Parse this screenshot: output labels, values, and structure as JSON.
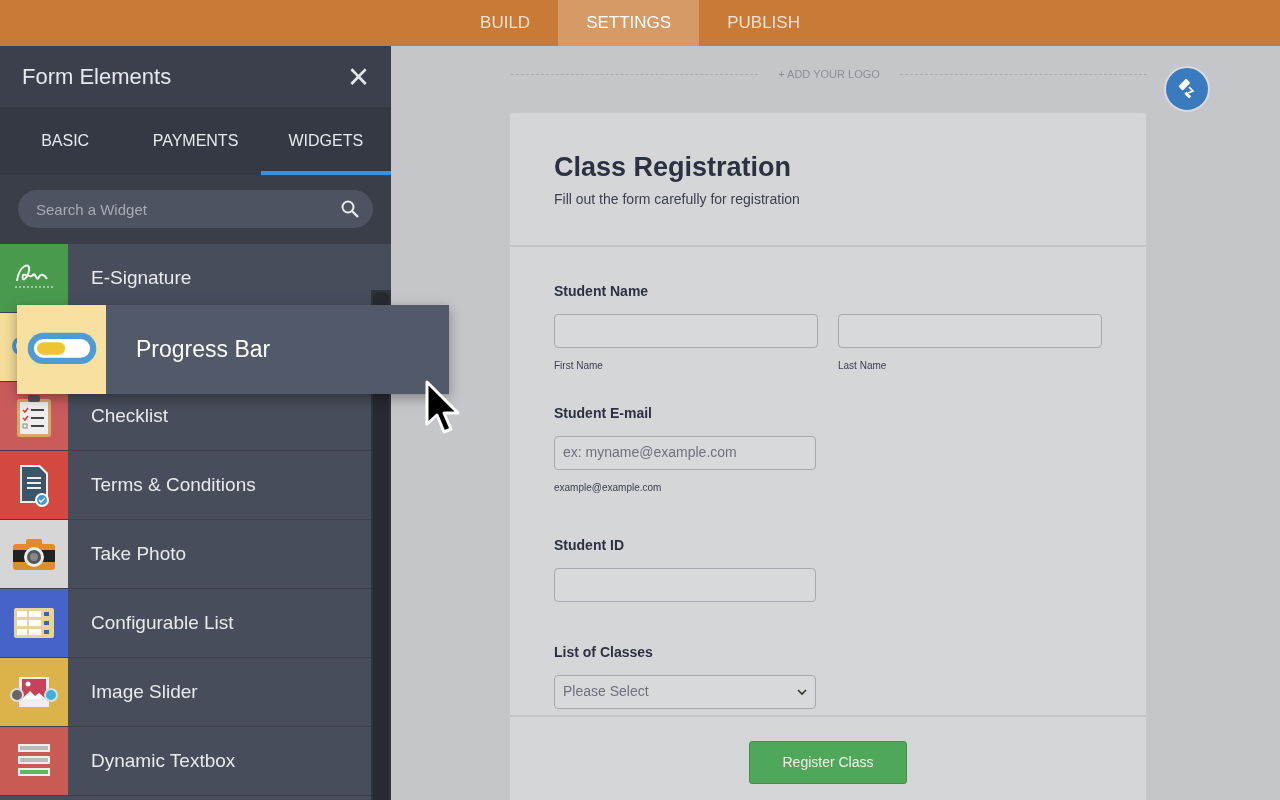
{
  "top_tabs": [
    {
      "label": "BUILD",
      "selected": false
    },
    {
      "label": "SETTINGS",
      "selected": true
    },
    {
      "label": "PUBLISH",
      "selected": false
    }
  ],
  "panel": {
    "title": "Form Elements",
    "close": "×",
    "tabs": [
      {
        "label": "BASIC",
        "selected": false
      },
      {
        "label": "PAYMENTS",
        "selected": false
      },
      {
        "label": "WIDGETS",
        "selected": true
      }
    ],
    "search": {
      "placeholder": "Search a Widget"
    },
    "items": [
      {
        "kind": "signature",
        "label": "E-Signature"
      },
      {
        "kind": "progress"
      },
      {
        "kind": "checklist",
        "label": "Checklist"
      },
      {
        "kind": "terms",
        "label": "Terms & Conditions"
      },
      {
        "kind": "camera",
        "label": "Take Photo"
      },
      {
        "kind": "grid",
        "label": "Configurable List"
      },
      {
        "kind": "slider",
        "label": "Image Slider"
      },
      {
        "kind": "textbox",
        "label": "Dynamic Textbox"
      }
    ],
    "dragged": {
      "kind": "progress",
      "label": "Progress Bar"
    }
  },
  "logo": "+ ADD YOUR LOGO",
  "form": {
    "title": "Class Registration",
    "subtitle": "Fill out the form carefully for registration",
    "fields": [
      {
        "kind": "name",
        "label": "Student Name",
        "subs": [
          "First Name",
          "Last Name"
        ]
      },
      {
        "kind": "text",
        "label": "Student E-mail",
        "placeholder": "ex: myname@example.com",
        "hint": "example@example.com"
      },
      {
        "kind": "text",
        "label": "Student ID"
      },
      {
        "kind": "select",
        "label": "List of Classes",
        "value": "Please Select"
      }
    ],
    "submit": "Register Class"
  }
}
